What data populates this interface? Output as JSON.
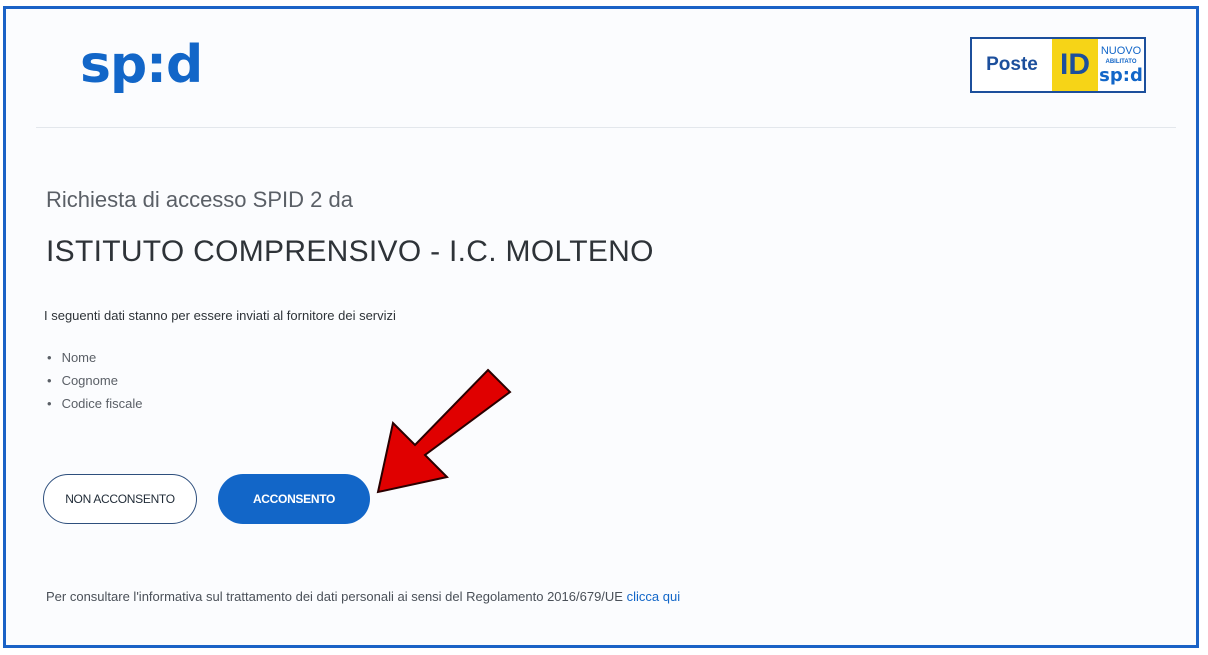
{
  "header": {
    "spid_logo_text": "sp:d",
    "poste_logo": {
      "poste": "Poste",
      "id": "ID",
      "nuovo": "NUOVO",
      "abilitato": "ABILITATO",
      "spid": "sp:d"
    }
  },
  "main": {
    "subtitle": "Richiesta di accesso SPID 2 da",
    "organization": "ISTITUTO COMPRENSIVO - I.C. MOLTENO",
    "intro": "I seguenti dati stanno per essere inviati al fornitore dei servizi",
    "attributes": [
      "Nome",
      "Cognome",
      "Codice fiscale"
    ]
  },
  "buttons": {
    "deny_label": "NON ACCONSENTO",
    "accept_label": "ACCONSENTO"
  },
  "footer": {
    "text": "Per consultare l'informativa sul trattamento dei dati personali ai sensi del Regolamento 2016/679/UE",
    "link_label": "clicca qui"
  },
  "annotation": {
    "arrow_color": "#e00000"
  },
  "colors": {
    "frame": "#1a62c6",
    "accent": "#1266c8"
  }
}
